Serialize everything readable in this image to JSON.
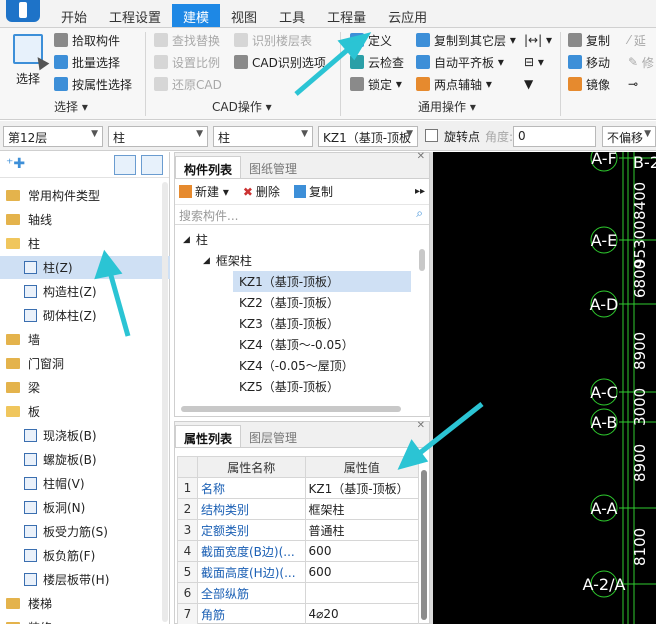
{
  "menubar": {
    "tabs": [
      "开始",
      "工程设置",
      "建模",
      "视图",
      "工具",
      "工程量",
      "云应用"
    ],
    "active_tab": "建模"
  },
  "ribbon": {
    "select_big": "选择",
    "select_items": [
      "拾取构件",
      "批量选择",
      "按属性选择"
    ],
    "select_group": "选择",
    "cad_items": [
      "查找替换",
      "识别楼层表",
      "设置比例",
      "CAD识别选项",
      "还原CAD"
    ],
    "cad_group": "CAD操作",
    "general_items": [
      "定义",
      "复制到其它层",
      "云检查",
      "自动平齐板",
      "锁定",
      "两点辅轴"
    ],
    "general_group": "通用操作",
    "edit_items": [
      "复制",
      "移动",
      "镜像"
    ],
    "edit_fragments": [
      "延",
      "修"
    ]
  },
  "toolbar": {
    "floor": "第12层",
    "type1": "柱",
    "type2": "柱",
    "component": "KZ1（基顶-顶板",
    "rotate_label": "旋转点",
    "angle_label": "角度:",
    "angle_value": "0",
    "offset": "不偏移"
  },
  "tree": {
    "items": [
      {
        "label": "常用构件类型",
        "level": 0,
        "open": false
      },
      {
        "label": "轴线",
        "level": 0,
        "open": false
      },
      {
        "label": "柱",
        "level": 0,
        "open": true
      },
      {
        "label": "柱(Z)",
        "level": 1,
        "selected": true
      },
      {
        "label": "构造柱(Z)",
        "level": 1
      },
      {
        "label": "砌体柱(Z)",
        "level": 1
      },
      {
        "label": "墙",
        "level": 0,
        "open": false
      },
      {
        "label": "门窗洞",
        "level": 0,
        "open": false
      },
      {
        "label": "梁",
        "level": 0,
        "open": false
      },
      {
        "label": "板",
        "level": 0,
        "open": true
      },
      {
        "label": "现浇板(B)",
        "level": 1
      },
      {
        "label": "螺旋板(B)",
        "level": 1
      },
      {
        "label": "柱帽(V)",
        "level": 1
      },
      {
        "label": "板洞(N)",
        "level": 1
      },
      {
        "label": "板受力筋(S)",
        "level": 1
      },
      {
        "label": "板负筋(F)",
        "level": 1
      },
      {
        "label": "楼层板带(H)",
        "level": 1
      },
      {
        "label": "楼梯",
        "level": 0,
        "open": false
      },
      {
        "label": "装修",
        "level": 0,
        "open": false
      }
    ]
  },
  "component_panel": {
    "tabs": [
      "构件列表",
      "图纸管理"
    ],
    "new": "新建",
    "delete": "删除",
    "copy": "复制",
    "search_placeholder": "搜索构件...",
    "root": "柱",
    "group": "框架柱",
    "items": [
      "KZ1（基顶-顶板）",
      "KZ2（基顶-顶板）",
      "KZ3（基顶-顶板）",
      "KZ4（基顶～-0.05）",
      "KZ4（-0.05～屋顶）",
      "KZ5（基顶-顶板）"
    ],
    "selected_index": 0
  },
  "property_panel": {
    "tabs": [
      "属性列表",
      "图层管理"
    ],
    "headers": [
      "属性名称",
      "属性值"
    ],
    "rows": [
      {
        "n": "1",
        "name": "名称",
        "value": "KZ1（基顶-顶板）"
      },
      {
        "n": "2",
        "name": "结构类别",
        "value": "框架柱"
      },
      {
        "n": "3",
        "name": "定额类别",
        "value": "普通柱"
      },
      {
        "n": "4",
        "name": "截面宽度(B边)(...",
        "value": "600"
      },
      {
        "n": "5",
        "name": "截面高度(H边)(...",
        "value": "600"
      },
      {
        "n": "6",
        "name": "全部纵筋",
        "value": ""
      },
      {
        "n": "7",
        "name": "角筋",
        "value": "4⌀20"
      }
    ]
  },
  "cad": {
    "axes": [
      "A-F",
      "A-E",
      "A-D",
      "A-C",
      "A-B",
      "A-A",
      "A-2/A"
    ],
    "top_right_label": "B-2",
    "dims": [
      "8400",
      "95300",
      "6800",
      "8900",
      "3000",
      "8900",
      "8100"
    ],
    "colors": {
      "axis_text": "#ffffff",
      "dim_text": "#ffffff",
      "line": "#2fcc2f"
    }
  },
  "colors": {
    "accent": "#1e88e5",
    "selection": "#cfe0f4",
    "arrow": "#2bc4d4"
  }
}
